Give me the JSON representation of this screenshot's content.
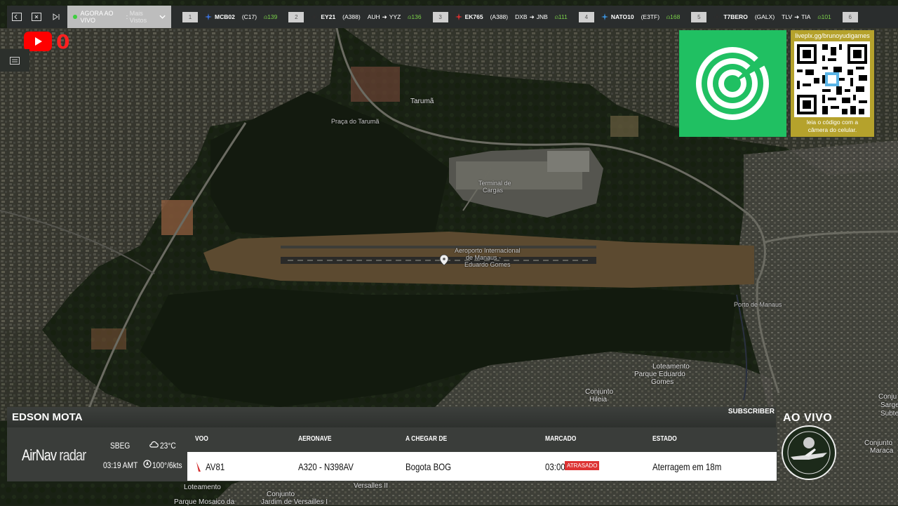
{
  "topbar": {
    "now_live_prefix": "AGORA AO VIVO",
    "now_live_selection": "Mais Vistos",
    "flights": [
      {
        "rank": "1",
        "callsign": "MCB02",
        "aircraft": "(C17)",
        "route_from": "",
        "route_to": "",
        "viewers": "139",
        "plane_color": "#3b6fd8"
      },
      {
        "rank": "2",
        "callsign": "EY21",
        "aircraft": "(A388)",
        "route_from": "AUH",
        "route_to": "YYZ",
        "viewers": "136",
        "plane_color": "#2d2d2d"
      },
      {
        "rank": "3",
        "callsign": "EK765",
        "aircraft": "(A388)",
        "route_from": "DXB",
        "route_to": "JNB",
        "viewers": "111",
        "plane_color": "#d32f2f"
      },
      {
        "rank": "4",
        "callsign": "NATO10",
        "aircraft": "(E3TF)",
        "route_from": "",
        "route_to": "",
        "viewers": "168",
        "plane_color": "#3b8fd8"
      },
      {
        "rank": "5",
        "callsign": "T7BERO",
        "aircraft": "(GALX)",
        "route_from": "TLV",
        "route_to": "TIA",
        "viewers": "101",
        "plane_color": "#2d2d2d"
      },
      {
        "rank": "6",
        "callsign": "",
        "aircraft": "",
        "route_from": "",
        "route_to": "",
        "viewers": "",
        "plane_color": "#2d2d2d"
      }
    ]
  },
  "youtube": {
    "count": "0"
  },
  "map_labels": {
    "taruma": "Tarumã",
    "praca_taruma": "Praça do Tarumã",
    "airport_line1": "Aeroporto Internacional",
    "airport_line2": "de Manaus -",
    "airport_line3": "Eduardo Gomes",
    "terminal_line1": "Terminal de",
    "terminal_line2": "Cargas",
    "porto": "Porto de Manaus",
    "loteamento_line1": "Loteamento",
    "loteamento_line2": "Parque Eduardo",
    "loteamento_line3": "Gomes",
    "conjunto_hileia1": "Conjunto",
    "conjunto_hileia2": "Hileia",
    "versailles": "Versalles II",
    "conjunto_jardim": "Conjunto",
    "jardim_versailles": "Jardim de Versailles I",
    "loteamento_parque": "Loteamento",
    "parque_mosaico": "Parque Mosaico da",
    "conjunto_sarge": "Conju",
    "sarge": "Sarge",
    "subte": "Subte",
    "conjunto_maraca": "Conjunto",
    "maraca": "Maraca"
  },
  "qr": {
    "url": "liveplx.gg/brunoyudigames",
    "caption_line1": "leia o código com a",
    "caption_line2": "câmera do celular."
  },
  "stream": {
    "streamer": "EDSON MOTA",
    "subscriber_label": "SUBSCRIBER",
    "ao_vivo": "AO VIVO"
  },
  "info": {
    "brand_main": "AirNav",
    "brand_sub": "radar",
    "airport_code": "SBEG",
    "local_time": "03:19 AMT",
    "temperature": "23°C",
    "wind": "100°/6kts",
    "headers": {
      "flight": "VOO",
      "aircraft": "AERONAVE",
      "arriving_from": "A CHEGAR DE",
      "scheduled": "MARCADO",
      "status": "ESTADO"
    },
    "row": {
      "flight": "AV81",
      "aircraft": "A320 - N398AV",
      "arriving_from": "Bogota BOG",
      "scheduled": "03:00",
      "delay_badge": "ATRASADO",
      "status": "Aterragem em 18m"
    }
  },
  "colors": {
    "accent_green": "#20c062",
    "qr_gold": "#b5a22c",
    "alert_red": "#d33333",
    "youtube_red": "#ff0000"
  }
}
